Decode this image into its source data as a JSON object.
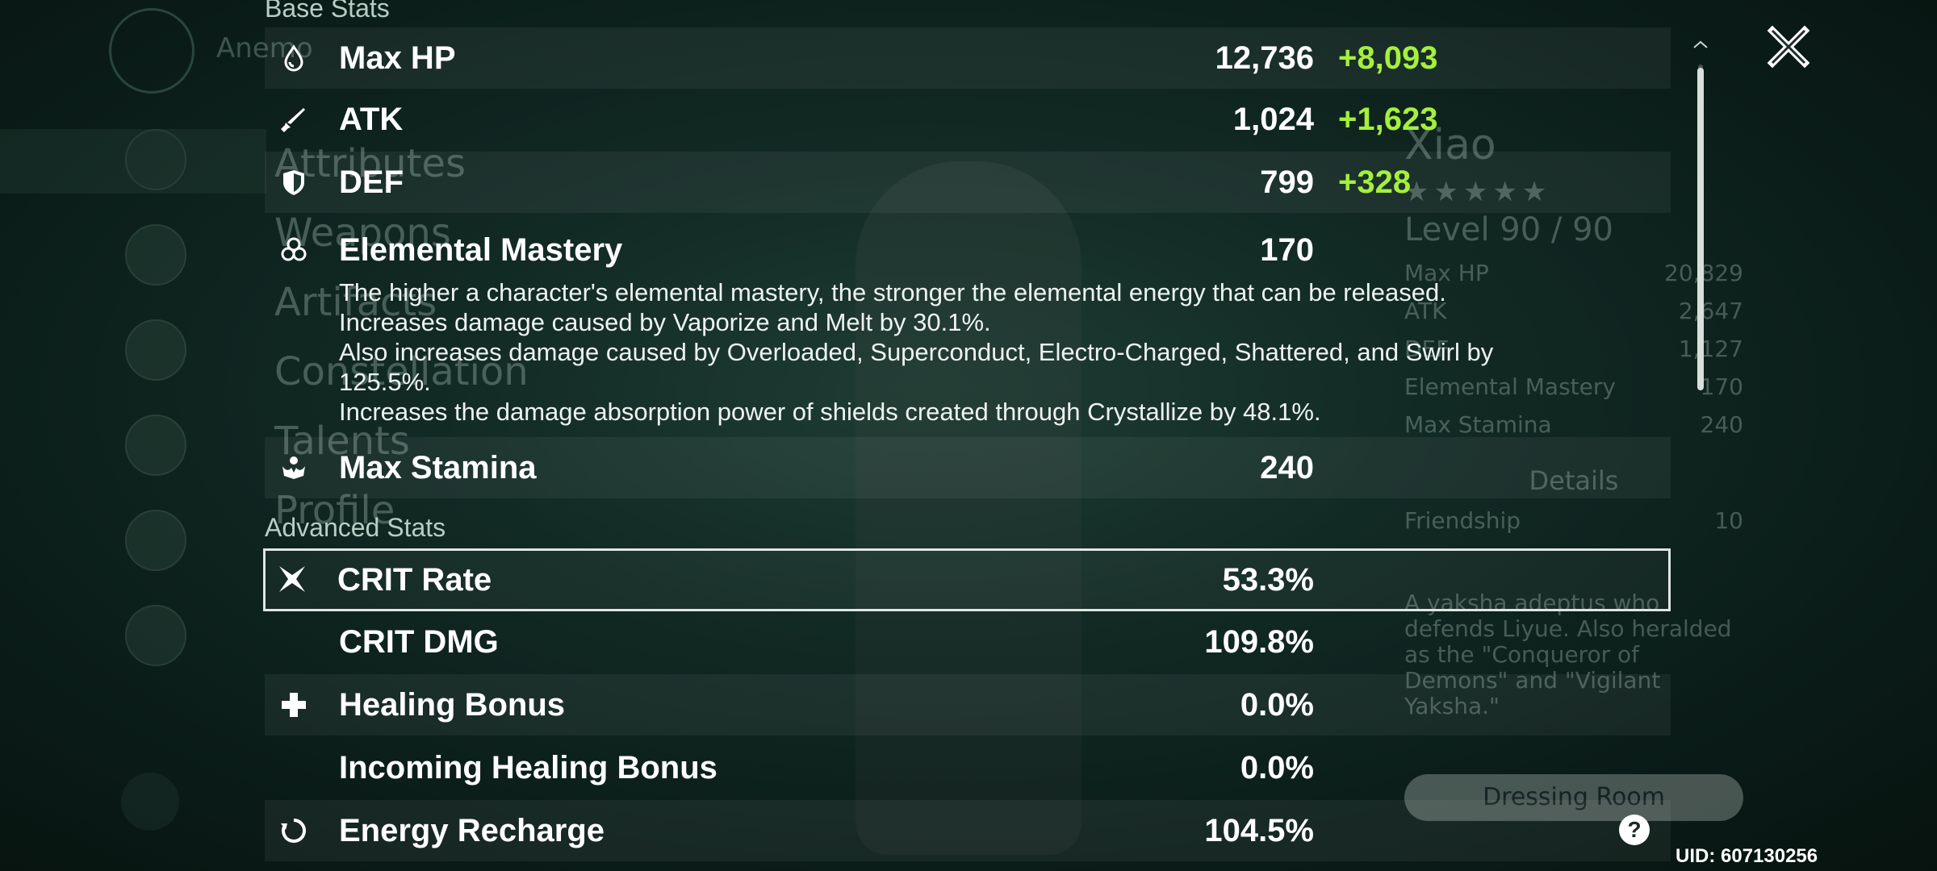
{
  "background": {
    "region_label": "Anemo",
    "tabs": [
      "Attributes",
      "Weapons",
      "Artifacts",
      "Constellation",
      "Talents",
      "Profile"
    ],
    "character_name": "Xiao",
    "stars": "★★★★★",
    "level": "Level 90 / 90",
    "mini_stats": [
      {
        "label": "Max HP",
        "value": "20,829"
      },
      {
        "label": "ATK",
        "value": "2,647"
      },
      {
        "label": "DEF",
        "value": "1,127"
      },
      {
        "label": "Elemental Mastery",
        "value": "170"
      },
      {
        "label": "Max Stamina",
        "value": "240"
      }
    ],
    "details_label": "Details",
    "friendship_label": "Friendship",
    "friendship_value": "10",
    "bio": "A yaksha adeptus who defends Liyue. Also heralded as the \"Conqueror of Demons\" and \"Vigilant Yaksha.\"",
    "dressing_room_label": "Dressing Room"
  },
  "sections": {
    "base": "Base Stats",
    "advanced": "Advanced Stats"
  },
  "base_stats": [
    {
      "icon": "hp-drop-icon",
      "name": "Max HP",
      "value": "12,736",
      "bonus": "+8,093"
    },
    {
      "icon": "sword-icon",
      "name": "ATK",
      "value": "1,024",
      "bonus": "+1,623"
    },
    {
      "icon": "shield-icon",
      "name": "DEF",
      "value": "799",
      "bonus": "+328"
    },
    {
      "icon": "mastery-icon",
      "name": "Elemental Mastery",
      "value": "170",
      "bonus": ""
    },
    {
      "icon": "stamina-icon",
      "name": "Max Stamina",
      "value": "240",
      "bonus": ""
    }
  ],
  "em_description": [
    "The higher a character's elemental mastery, the stronger the elemental energy that can be released.",
    "Increases damage caused by Vaporize and Melt by 30.1%.",
    "Also increases damage caused by Overloaded, Superconduct, Electro-Charged, Shattered, and Swirl by 125.5%.",
    "Increases the damage absorption power of shields created through Crystallize by 48.1%."
  ],
  "advanced_stats": [
    {
      "icon": "crit-star-icon",
      "name": "CRIT Rate",
      "value": "53.3%",
      "selected": true
    },
    {
      "icon": "",
      "name": "CRIT DMG",
      "value": "109.8%"
    },
    {
      "icon": "healing-cross-icon",
      "name": "Healing Bonus",
      "value": "0.0%"
    },
    {
      "icon": "",
      "name": "Incoming Healing Bonus",
      "value": "0.0%"
    },
    {
      "icon": "energy-recharge-icon",
      "name": "Energy Recharge",
      "value": "104.5%"
    }
  ],
  "uid": "UID: 607130256",
  "help_label": "?",
  "colors": {
    "bonus_green": "#a5f03c",
    "highlight_border": "#dfe6e2"
  }
}
